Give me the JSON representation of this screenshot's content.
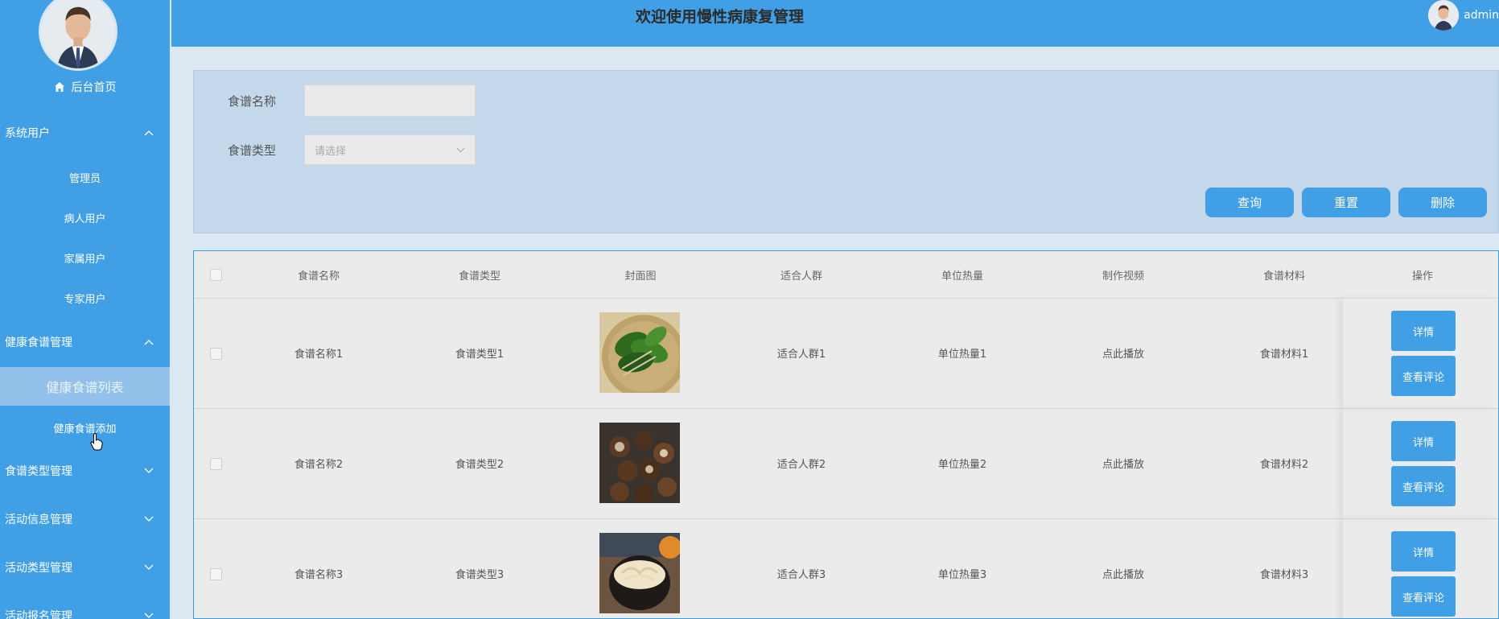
{
  "header": {
    "title": "欢迎使用慢性病康复管理",
    "username": "admin"
  },
  "sidebar": {
    "home_label": "后台首页",
    "groups": [
      {
        "label": "系统用户",
        "expanded": true,
        "items": [
          "管理员",
          "病人用户",
          "家属用户",
          "专家用户"
        ]
      },
      {
        "label": "健康食谱管理",
        "expanded": true,
        "items": [
          "健康食谱列表",
          "健康食谱添加"
        ],
        "active_item": "健康食谱列表"
      },
      {
        "label": "食谱类型管理",
        "expanded": false
      },
      {
        "label": "活动信息管理",
        "expanded": false
      },
      {
        "label": "活动类型管理",
        "expanded": false
      },
      {
        "label": "活动报名管理",
        "expanded": false
      }
    ]
  },
  "search": {
    "name_label": "食谱名称",
    "name_value": "",
    "type_label": "食谱类型",
    "type_placeholder": "请选择",
    "query_label": "查询",
    "reset_label": "重置",
    "delete_label": "删除"
  },
  "table": {
    "columns": [
      "食谱名称",
      "食谱类型",
      "封面图",
      "适合人群",
      "单位热量",
      "制作视频",
      "食谱材料",
      "操作"
    ],
    "rows": [
      {
        "name": "食谱名称1",
        "type": "食谱类型1",
        "cover": "spinach-image",
        "crowd": "适合人群1",
        "calorie": "单位热量1",
        "video": "点此播放",
        "material": "食谱材料1"
      },
      {
        "name": "食谱名称2",
        "type": "食谱类型2",
        "cover": "mushroom-image",
        "crowd": "适合人群2",
        "calorie": "单位热量2",
        "video": "点此播放",
        "material": "食谱材料2"
      },
      {
        "name": "食谱名称3",
        "type": "食谱类型3",
        "cover": "bamboo-shoot-image",
        "crowd": "适合人群3",
        "calorie": "单位热量3",
        "video": "点此播放",
        "material": "食谱材料3"
      }
    ],
    "detail_label": "详情",
    "comments_label": "查看评论"
  },
  "colors": {
    "primary": "#41a0e5",
    "sidebar_active": "#94c1e9",
    "panel": "#c3d8ea",
    "table_bg": "#ebebeb"
  }
}
